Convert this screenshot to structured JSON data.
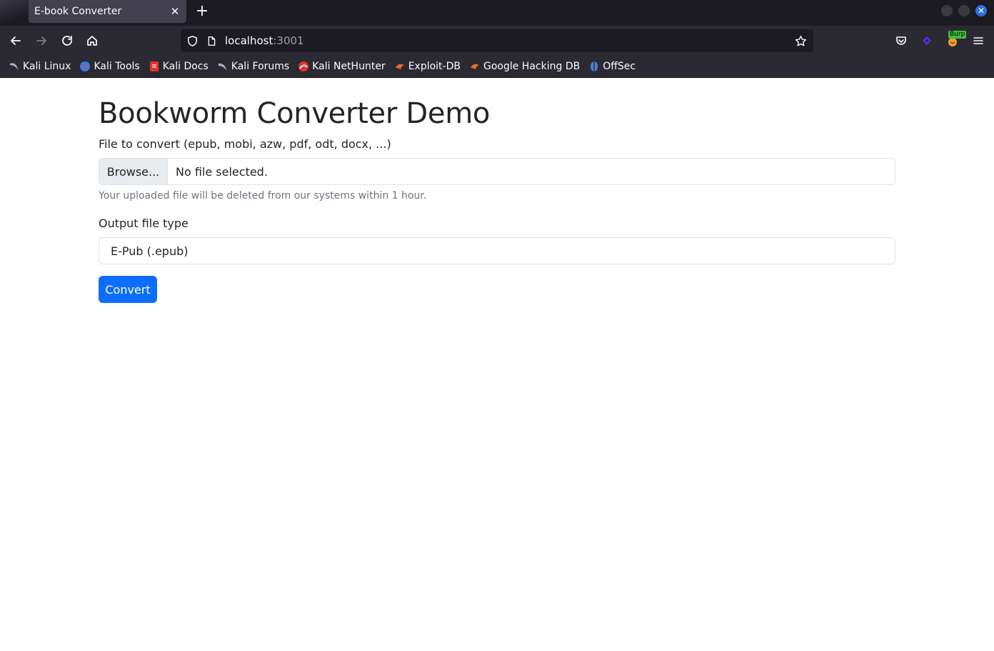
{
  "browser": {
    "tab": {
      "title": "E-book Converter",
      "close_glyph": "✕"
    },
    "new_tab_glyph": "+",
    "window_close_glyph": "✕",
    "url": {
      "host": "localhost",
      "port": ":3001"
    },
    "icons": [
      "back-icon",
      "forward-icon",
      "reload-icon",
      "home-icon",
      "shield-icon",
      "page-icon",
      "star-icon",
      "pocket-icon",
      "extension-icon",
      "burp-icon",
      "menu-icon"
    ],
    "burp_badge": "Burp",
    "bookmarks": [
      {
        "label": "Kali Linux",
        "icon": "kali-dragon-icon",
        "color": "#9aa0a6"
      },
      {
        "label": "Kali Tools",
        "icon": "kali-tools-icon",
        "color": "#367bf0"
      },
      {
        "label": "Kali Docs",
        "icon": "kali-docs-icon",
        "color": "#e0322b"
      },
      {
        "label": "Kali Forums",
        "icon": "kali-forums-icon",
        "color": "#9aa0a6"
      },
      {
        "label": "Kali NetHunter",
        "icon": "nethunter-icon",
        "color": "#e0322b"
      },
      {
        "label": "Exploit-DB",
        "icon": "exploit-db-icon",
        "color": "#ec6a2c"
      },
      {
        "label": "Google Hacking DB",
        "icon": "ghdb-icon",
        "color": "#ec6a2c"
      },
      {
        "label": "OffSec",
        "icon": "offsec-icon",
        "color": "#4a7fd8"
      }
    ]
  },
  "page": {
    "title": "Bookworm Converter Demo",
    "file_label": "File to convert (epub, mobi, azw, pdf, odt, docx, ...)",
    "browse_label": "Browse...",
    "file_status": "No file selected.",
    "help_text": "Your uploaded file will be deleted from our systems within 1 hour.",
    "output_label": "Output file type",
    "output_selected": "E-Pub (.epub)",
    "convert_label": "Convert",
    "accent": "#0d6efd"
  }
}
